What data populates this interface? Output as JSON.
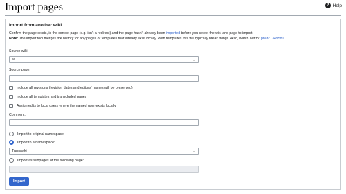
{
  "page": {
    "title": "Import pages"
  },
  "help": {
    "label": "Help",
    "glyph": "?"
  },
  "form": {
    "legend": "Import from another wiki",
    "intro_1": "Confirm the page exists, is the correct page (e.g. isn't a redirect) and the page hasn't already been ",
    "intro_link": "imported",
    "intro_2": " before you select the wiki and page to import.",
    "note_label": "Note:",
    "note_text": " The import tool merges the history for any pages or templates that already exist locally. With templates this will typically break things. Also, watch out for ",
    "note_link": "phab:T349580",
    "note_end": ".",
    "source_wiki_label": "Source wiki:",
    "source_wiki_value": "w",
    "source_page_label": "Source page:",
    "source_page_value": "",
    "cb_revisions": "Include all revisions (revision dates and editors' names will be preserved)",
    "cb_templates": "Include all templates and transcluded pages",
    "cb_assign": "Assign edits to local users where the named user exists locally",
    "comment_label": "Comment:",
    "comment_value": "",
    "radio_original": "Import to original namespace",
    "radio_namespace": "Import to a namespace:",
    "namespace_value": "Transwiki",
    "radio_subpages": "Import as subpages of the following page:",
    "subpage_value": "",
    "submit": "Import"
  },
  "colors": {
    "accent": "#3366cc",
    "text": "#202122",
    "border": "#a2a9b1"
  }
}
